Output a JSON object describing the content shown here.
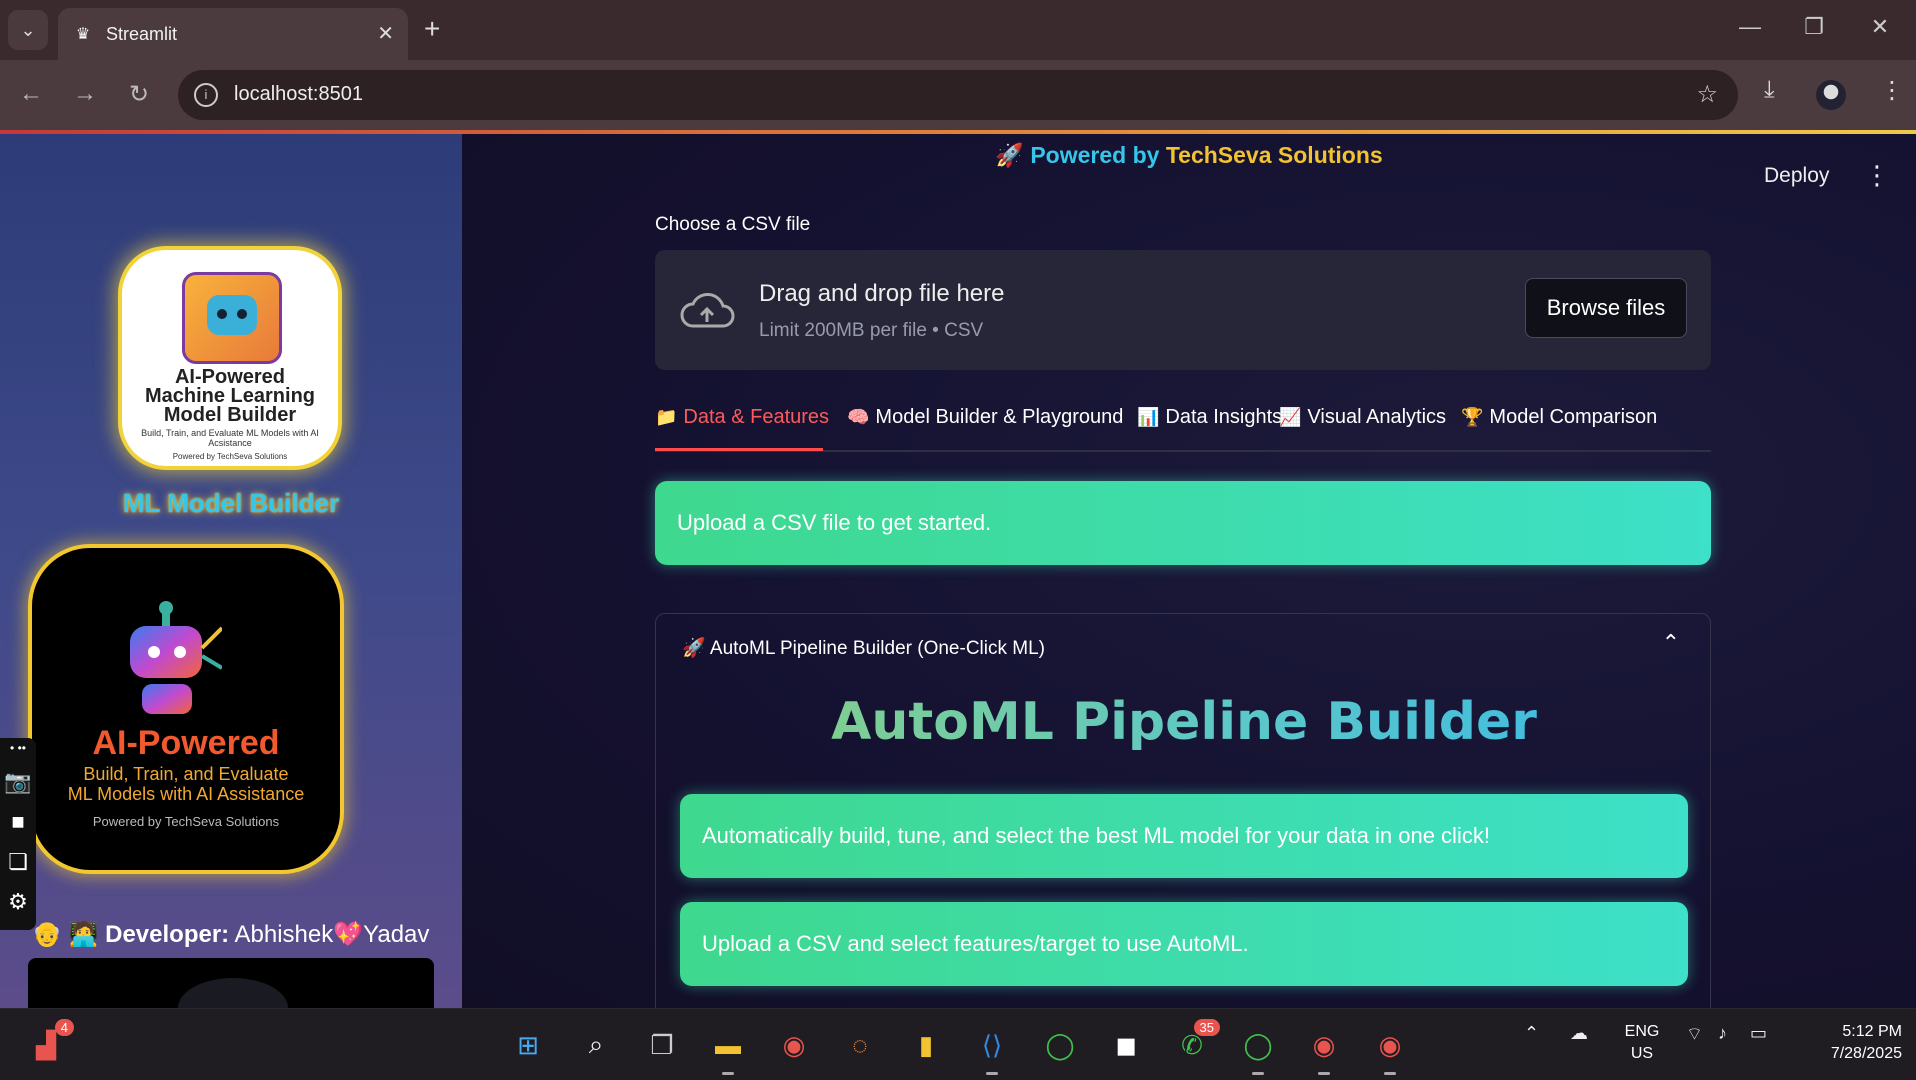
{
  "browser": {
    "tab_title": "Streamlit",
    "url": "localhost:8501"
  },
  "sidebar": {
    "logo1": {
      "title_lines": [
        "AI-Powered",
        "Machine Learning",
        "Model Builder"
      ],
      "subtitle": "Build, Train, and Evaluate ML Models with AI Acsistance",
      "powered": "Powered by TechSeva Solutions"
    },
    "brand_name": "ML Model Builder",
    "logo2": {
      "title": "AI-Powered",
      "subtitle_1": "Build, Train, and Evaluate",
      "subtitle_2": "ML Models with AI Assistance",
      "powered": "Powered by TechSeva Solutions"
    },
    "developer_emoji": "👴 🧑‍💻",
    "developer_label": "Developer:",
    "developer_first": "Abhishek",
    "developer_heart": "💖",
    "developer_last": "Yadav"
  },
  "header": {
    "powered_emoji": "🚀",
    "powered_by": "Powered by",
    "company": "TechSeva Solutions",
    "deploy_label": "Deploy"
  },
  "uploader": {
    "label": "Choose a CSV file",
    "drag_text": "Drag and drop file here",
    "limit_text": "Limit 200MB per file • CSV",
    "browse_label": "Browse files"
  },
  "tabs": [
    {
      "icon": "📁",
      "label": "Data & Features"
    },
    {
      "icon": "🧠",
      "label": "Model Builder & Playground"
    },
    {
      "icon": "📊",
      "label": "Data Insights"
    },
    {
      "icon": "📈",
      "label": "Visual Analytics"
    },
    {
      "icon": "🏆",
      "label": "Model Comparison"
    }
  ],
  "upload_notice": "Upload a CSV file to get started.",
  "automl": {
    "expander_icon": "🚀",
    "expander_label": "AutoML Pipeline Builder (One-Click ML)",
    "title": "AutoML Pipeline Builder",
    "info_1": "Automatically build, tune, and select the best ML model for your data in one click!",
    "info_2": "Upload a CSV and select features/target to use AutoML."
  },
  "taskbar": {
    "badge_left": "4",
    "badge_whatsapp": "35",
    "lang_1": "ENG",
    "lang_2": "US",
    "time": "5:12 PM",
    "date": "7/28/2025"
  },
  "colors": {
    "accent_red": "#ff4b4b",
    "info_green": "#3ed88e",
    "info_teal": "#3de0c8",
    "brand_cyan": "#36c6ea",
    "brand_gold": "#f2c230"
  }
}
